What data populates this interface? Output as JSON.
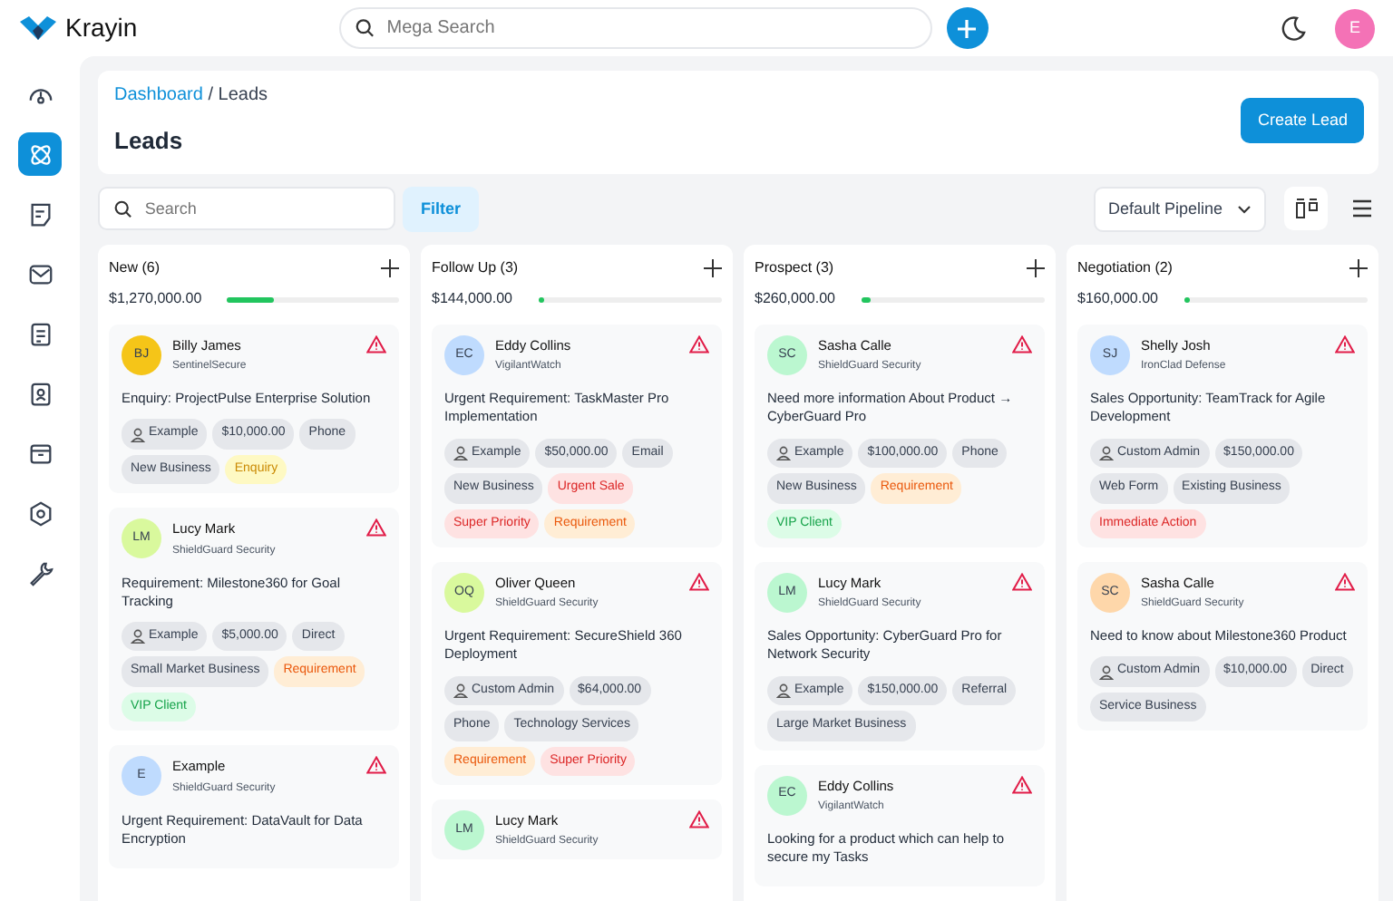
{
  "app": {
    "name": "Krayin"
  },
  "search": {
    "placeholder": "Mega Search"
  },
  "user": {
    "initial": "E"
  },
  "sidebar": {
    "items": [
      {
        "kind": "dashboard",
        "selected": false
      },
      {
        "kind": "leads",
        "selected": true
      },
      {
        "kind": "quotes",
        "selected": false
      },
      {
        "kind": "mail",
        "selected": false
      },
      {
        "kind": "activities",
        "selected": false
      },
      {
        "kind": "contacts",
        "selected": false
      },
      {
        "kind": "products",
        "selected": false
      },
      {
        "kind": "settings",
        "selected": false
      },
      {
        "kind": "tools",
        "selected": false
      }
    ]
  },
  "breadcrumb": {
    "link": "Dashboard",
    "separator": "/",
    "current": "Leads"
  },
  "page_title": "Leads",
  "create_button": "Create Lead",
  "toolbar": {
    "search_placeholder": "Search",
    "filter_button": "Filter",
    "pipeline": "Default Pipeline"
  },
  "columns": [
    {
      "name": "New (6)",
      "total": "$1,270,000.00",
      "level": 0.27,
      "leads": [
        {
          "initials": "BJ",
          "name": "Billy James",
          "company": "SentinelSecure",
          "color": "#f5c518",
          "title": "Enquiry: ProjectPulse Enterprise Solution",
          "tags": [
            {
              "kind": "person",
              "text": "Example"
            },
            {
              "kind": "plain",
              "text": "$10,000.00"
            },
            {
              "kind": "plain",
              "text": "Phone"
            },
            {
              "kind": "plain",
              "text": "New Business"
            },
            {
              "kind": "yellow",
              "text": "Enquiry"
            }
          ]
        },
        {
          "initials": "LM",
          "name": "Lucy Mark",
          "company": "ShieldGuard Security",
          "color": "#d9f99d",
          "title": "Requirement: Milestone360 for Goal Tracking",
          "tags": [
            {
              "kind": "person",
              "text": "Example"
            },
            {
              "kind": "plain",
              "text": "$5,000.00"
            },
            {
              "kind": "plain",
              "text": "Direct"
            },
            {
              "kind": "plain",
              "text": "Small Market Business"
            },
            {
              "kind": "orange",
              "text": "Requirement"
            },
            {
              "kind": "green",
              "text": "VIP Client"
            }
          ]
        },
        {
          "initials": "E",
          "name": "Example",
          "company": "ShieldGuard Security",
          "color": "#bfdbfe",
          "title": "Urgent Requirement: DataVault for Data Encryption"
        }
      ]
    },
    {
      "name": "Follow Up (3)",
      "total": "$144,000.00",
      "level": 0.02,
      "leads": [
        {
          "initials": "EC",
          "name": "Eddy Collins",
          "company": "VigilantWatch",
          "color": "#bfdbfe",
          "title": "Urgent Requirement: TaskMaster Pro Implementation",
          "tags": [
            {
              "kind": "person",
              "text": "Example"
            },
            {
              "kind": "plain",
              "text": "$50,000.00"
            },
            {
              "kind": "plain",
              "text": "Email"
            },
            {
              "kind": "plain",
              "text": "New Business"
            },
            {
              "kind": "red",
              "text": "Urgent Sale"
            },
            {
              "kind": "red",
              "text": "Super Priority"
            },
            {
              "kind": "orange",
              "text": "Requirement"
            }
          ]
        },
        {
          "initials": "OQ",
          "name": "Oliver Queen",
          "company": "ShieldGuard Security",
          "color": "#d9f99d",
          "title": "Urgent Requirement: SecureShield 360 Deployment",
          "tags": [
            {
              "kind": "person",
              "text": "Custom Admin"
            },
            {
              "kind": "plain",
              "text": "$64,000.00"
            },
            {
              "kind": "plain",
              "text": "Phone"
            },
            {
              "kind": "plain",
              "text": "Technology Services"
            },
            {
              "kind": "orange",
              "text": "Requirement"
            },
            {
              "kind": "red",
              "text": "Super Priority"
            }
          ]
        },
        {
          "initials": "LM",
          "name": "Lucy Mark",
          "company": "ShieldGuard Security",
          "color": "#bbf7d0"
        }
      ]
    },
    {
      "name": "Prospect (3)",
      "total": "$260,000.00",
      "level": 0.05,
      "leads": [
        {
          "initials": "SC",
          "name": "Sasha Calle",
          "company": "ShieldGuard Security",
          "color": "#bbf7d0",
          "title": "Need more information About Product → CyberGuard Pro",
          "tags": [
            {
              "kind": "person",
              "text": "Example"
            },
            {
              "kind": "plain",
              "text": "$100,000.00"
            },
            {
              "kind": "plain",
              "text": "Phone"
            },
            {
              "kind": "plain",
              "text": "New Business"
            },
            {
              "kind": "orange",
              "text": "Requirement"
            },
            {
              "kind": "green",
              "text": "VIP Client"
            }
          ]
        },
        {
          "initials": "LM",
          "name": "Lucy Mark",
          "company": "ShieldGuard Security",
          "color": "#bbf7d0",
          "title": "Sales Opportunity: CyberGuard Pro for Network Security",
          "tags": [
            {
              "kind": "person",
              "text": "Example"
            },
            {
              "kind": "plain",
              "text": "$150,000.00"
            },
            {
              "kind": "plain",
              "text": "Referral"
            },
            {
              "kind": "plain",
              "text": "Large Market Business"
            }
          ]
        },
        {
          "initials": "EC",
          "name": "Eddy Collins",
          "company": "VigilantWatch",
          "color": "#bbf7d0",
          "title": "Looking for a product which can help to secure my Tasks"
        }
      ]
    },
    {
      "name": "Negotiation (2)",
      "total": "$160,000.00",
      "level": 0.02,
      "leads": [
        {
          "initials": "SJ",
          "name": "Shelly Josh",
          "company": "IronClad Defense",
          "color": "#bfdbfe",
          "title": "Sales Opportunity: TeamTrack for Agile Development",
          "tags": [
            {
              "kind": "person",
              "text": "Custom Admin"
            },
            {
              "kind": "plain",
              "text": "$150,000.00"
            },
            {
              "kind": "plain",
              "text": "Web Form"
            },
            {
              "kind": "plain",
              "text": "Existing Business"
            },
            {
              "kind": "red",
              "text": "Immediate Action"
            }
          ]
        },
        {
          "initials": "SC",
          "name": "Sasha Calle",
          "company": "ShieldGuard Security",
          "color": "#fed7aa",
          "title": "Need to know about Milestone360 Product",
          "tags": [
            {
              "kind": "person",
              "text": "Custom Admin"
            },
            {
              "kind": "plain",
              "text": "$10,000.00"
            },
            {
              "kind": "plain",
              "text": "Direct"
            },
            {
              "kind": "plain",
              "text": "Service Business"
            }
          ]
        }
      ]
    }
  ]
}
